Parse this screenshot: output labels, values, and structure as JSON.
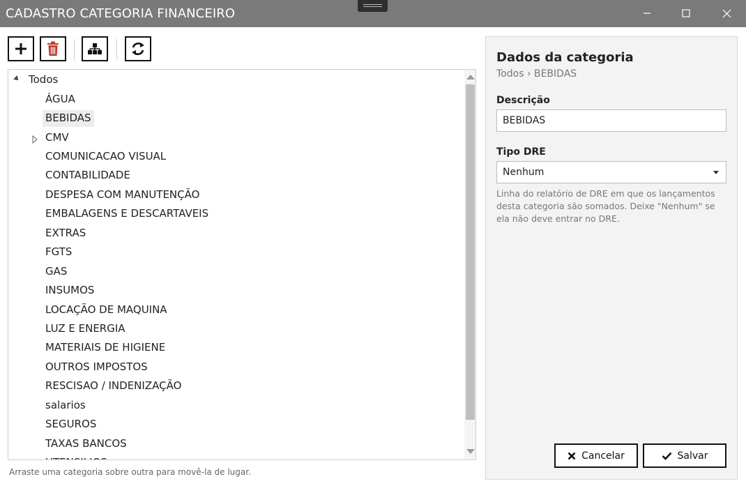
{
  "window": {
    "title": "CADASTRO CATEGORIA FINANCEIRO"
  },
  "toolbar": {
    "buttons": [
      {
        "name": "add",
        "icon": "plus-icon"
      },
      {
        "name": "delete",
        "icon": "trash-icon",
        "color": "#c0392b"
      },
      {
        "name": "hierarchy",
        "icon": "hierarchy-icon"
      },
      {
        "name": "refresh",
        "icon": "refresh-icon"
      }
    ]
  },
  "tree": {
    "root": "Todos",
    "items": [
      "ÁGUA",
      "BEBIDAS",
      "CMV",
      "COMUNICACAO VISUAL",
      "CONTABILIDADE",
      "DESPESA COM MANUTENÇÃO",
      "EMBALAGENS E DESCARTAVEIS",
      "EXTRAS",
      "FGTS",
      "GAS",
      "INSUMOS",
      "LOCAÇÃO DE MAQUINA",
      "LUZ E ENERGIA",
      "MATERIAIS DE HIGIENE",
      "OUTROS IMPOSTOS",
      "RESCISAO / INDENIZAÇÃO",
      "salarios",
      "SEGUROS",
      "TAXAS BANCOS",
      "UTENSILIOS"
    ],
    "selected": "BEBIDAS",
    "expandable": [
      "CMV"
    ]
  },
  "hint": "Arraste uma categoria sobre outra para movê-la de lugar.",
  "panel": {
    "title": "Dados da categoria",
    "breadcrumb": "Todos › BEBIDAS",
    "descricao_label": "Descrição",
    "descricao_value": "BEBIDAS",
    "tipo_label": "Tipo DRE",
    "tipo_value": "Nenhum",
    "help": "Linha do relatório de DRE em que os lançamentos desta categoria são somados. Deixe \"Nenhum\" se ela não deve entrar no DRE.",
    "cancel_label": "Cancelar",
    "save_label": "Salvar"
  }
}
